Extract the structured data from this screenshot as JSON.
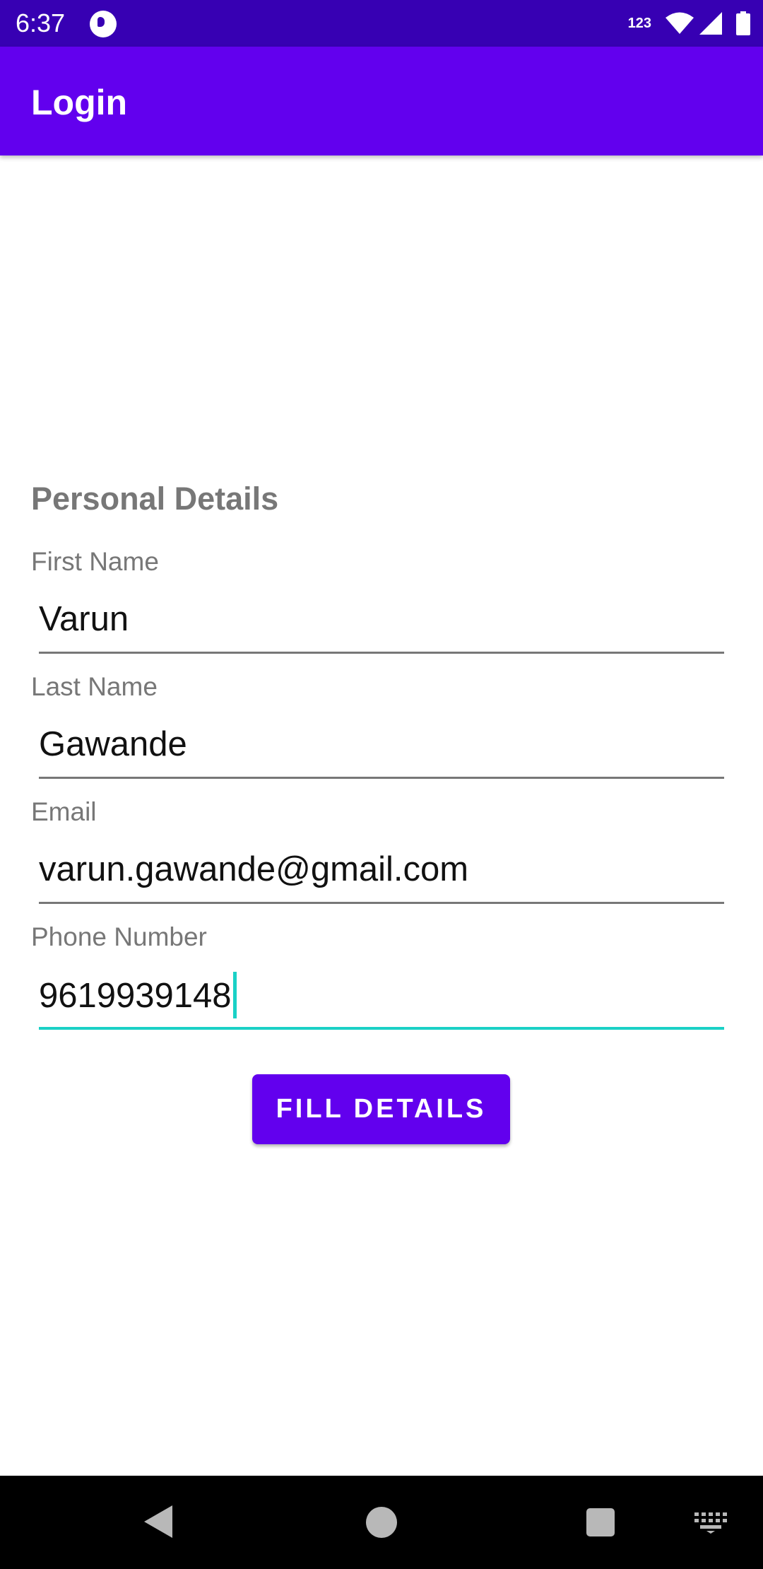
{
  "status_bar": {
    "time": "6:37",
    "network_label": "123",
    "icons": [
      "app-icon",
      "wifi-icon",
      "signal-icon",
      "battery-icon"
    ]
  },
  "app_bar": {
    "title": "Login",
    "color": "#6200EE"
  },
  "form": {
    "section_title": "Personal Details",
    "fields": [
      {
        "label": "First Name",
        "value": "Varun"
      },
      {
        "label": "Last Name",
        "value": "Gawande"
      },
      {
        "label": "Email",
        "value": "varun.gawande@gmail.com"
      },
      {
        "label": "Phone Number",
        "value": "9619939148"
      }
    ],
    "focused_field": "Phone Number",
    "focus_color": "#1ad1c6"
  },
  "button": {
    "label": "FILL DETAILS",
    "color": "#6200EE"
  },
  "nav_bar": {
    "icons": [
      "back-icon",
      "home-icon",
      "recents-icon",
      "keyboard-icon"
    ]
  }
}
